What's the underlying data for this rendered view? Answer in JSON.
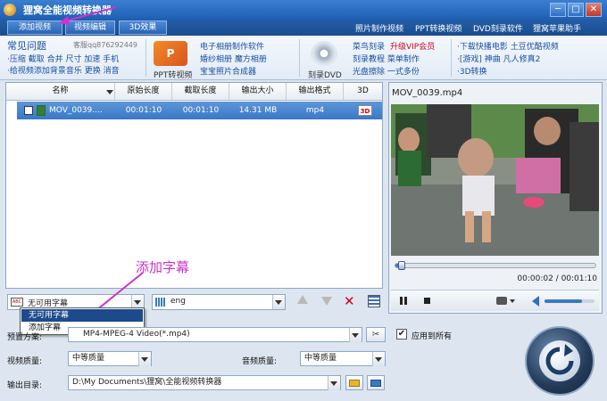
{
  "window": {
    "title": "狸窝全能视频转换器",
    "controls": {
      "min": "─",
      "max": "□",
      "close": "✕"
    }
  },
  "tabs": [
    "添加视频",
    "视频编辑",
    "3D效果"
  ],
  "top_links": [
    "照片制作视频",
    "PPT转换视频",
    "DVD刻录软件",
    "狸窝苹果助手"
  ],
  "ads": {
    "faq_title": "常见问题",
    "qq": "客服qq876292449",
    "faq_line1": "·压缩 截取 合并 尺寸 加速 手机",
    "faq_line2": "·给视频添加背景音乐 更换 消音",
    "ppt_label": "PPT转视频",
    "col2": [
      "电子相册制作软件",
      "婚纱相册 魔方相册",
      "宝宝照片合成器"
    ],
    "dvd_label": "刻录DVD",
    "col3a": "菜鸟刻录",
    "col3b": "升级VIP会员",
    "col3": [
      "刻录教程 菜单制作",
      "光盘擦除 一式多份"
    ],
    "col4": [
      "·下载快播电影 土豆优酷视频",
      "·[游戏] 神曲 凡人修真2",
      "·3D转换"
    ]
  },
  "table": {
    "headers": [
      "名称",
      "原始长度",
      "截取长度",
      "输出大小",
      "输出格式",
      "3D"
    ],
    "rows": [
      {
        "name": "MOV_0039....",
        "orig": "00:01:10",
        "cut": "00:01:10",
        "size": "14.31 MB",
        "format": "mp4",
        "threeD": "3D"
      }
    ]
  },
  "preview": {
    "filename": "MOV_0039.mp4",
    "time": "00:00:02 / 00:01:10",
    "progress": 0.03,
    "volume": 0.75
  },
  "subtitle": {
    "selected": "无可用字幕",
    "options": [
      "无可用字幕",
      "添加字幕"
    ],
    "audio_track": "eng",
    "annotation": "添加字幕"
  },
  "settings": {
    "preset_label": "预置方案:",
    "preset_value": "MP4-MPEG-4 Video(*.mp4)",
    "apply_all": "应用到所有",
    "video_quality_label": "视频质量:",
    "video_quality": "中等质量",
    "audio_quality_label": "音频质量:",
    "audio_quality": "中等质量",
    "output_label": "输出目录:",
    "output_dir": "D:\\My Documents\\狸窝\\全能视频转换器"
  },
  "colors": {
    "accent": "#3a78c6",
    "annotation": "#cc33cc",
    "link": "#1a4fa0"
  }
}
